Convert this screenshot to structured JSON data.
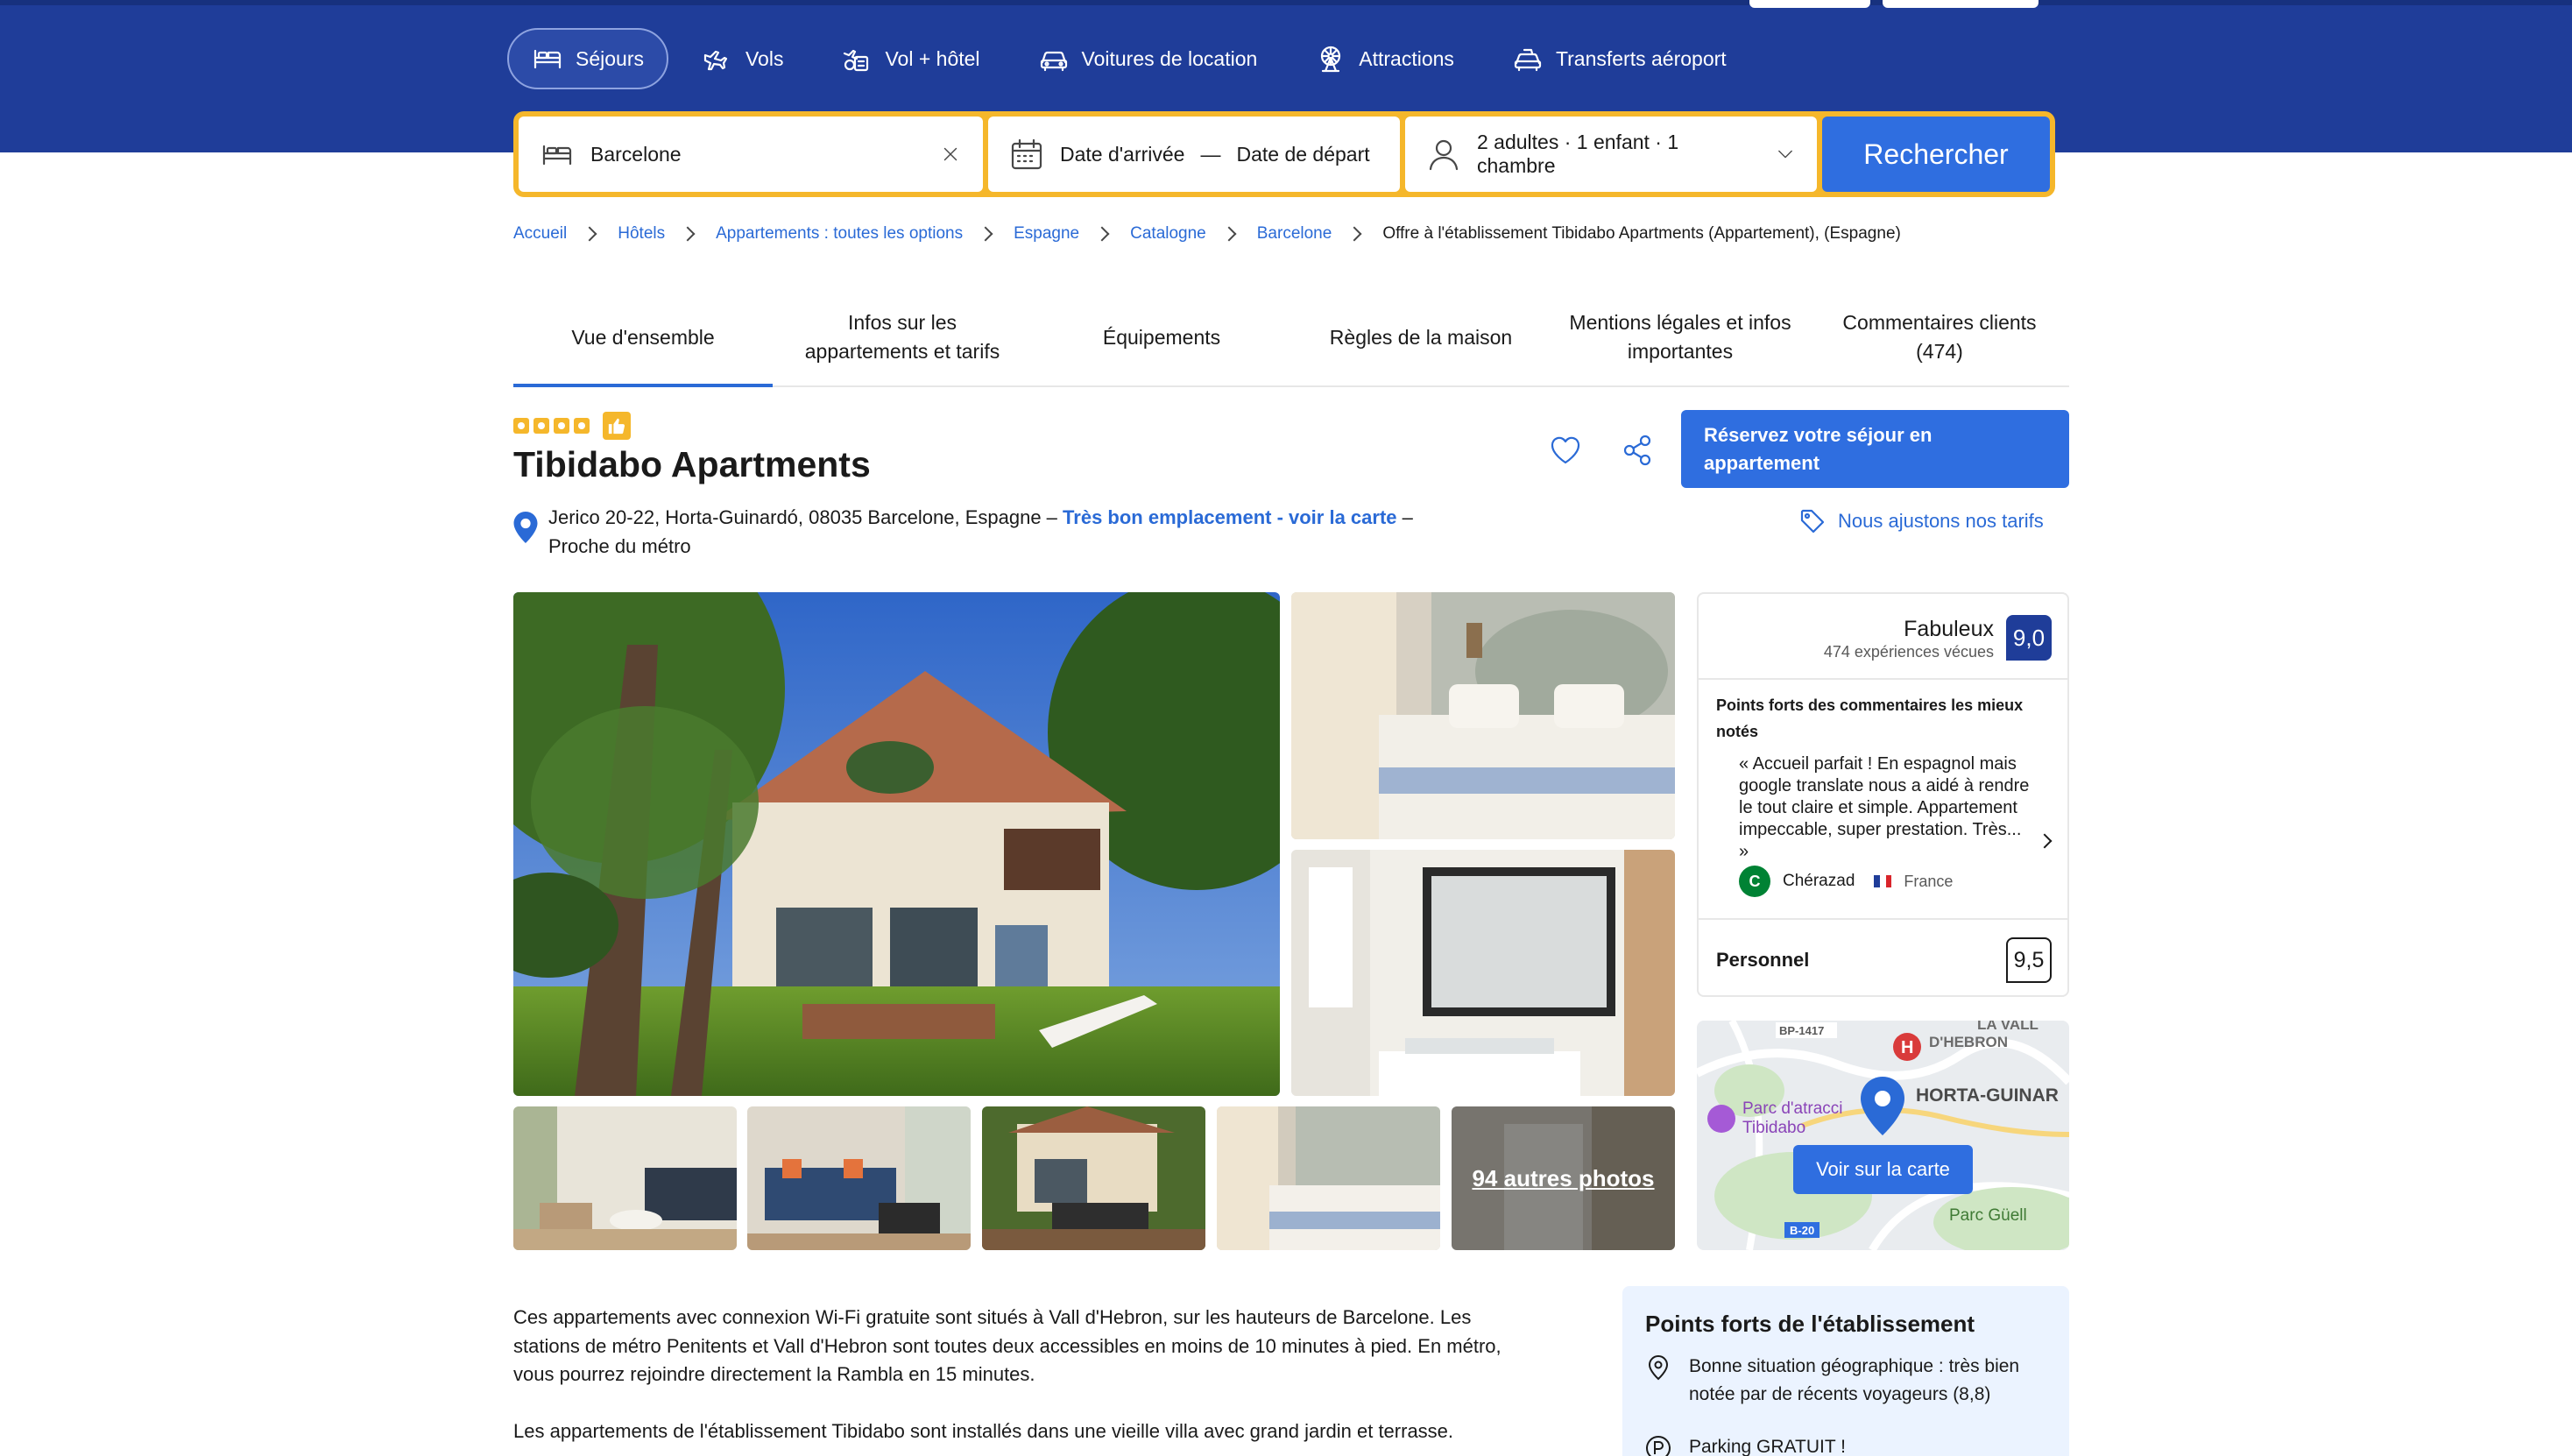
{
  "nav": {
    "items": [
      {
        "label": "Séjours",
        "icon": "bed-icon",
        "active": true
      },
      {
        "label": "Vols",
        "icon": "plane-icon",
        "active": false
      },
      {
        "label": "Vol + hôtel",
        "icon": "plane-hotel-icon",
        "active": false
      },
      {
        "label": "Voitures de location",
        "icon": "car-icon",
        "active": false
      },
      {
        "label": "Attractions",
        "icon": "ferris-wheel-icon",
        "active": false
      },
      {
        "label": "Transferts aéroport",
        "icon": "taxi-icon",
        "active": false
      }
    ]
  },
  "search": {
    "destination": "Barcelone",
    "checkin": "Date d'arrivée",
    "separator": "—",
    "checkout": "Date de départ",
    "guests": "2 adultes · 1 enfant · 1 chambre",
    "button": "Rechercher"
  },
  "breadcrumb": {
    "items": [
      "Accueil",
      "Hôtels",
      "Appartements : toutes les options",
      "Espagne",
      "Catalogne",
      "Barcelone"
    ],
    "current": "Offre à l'établissement Tibidabo Apartments (Appartement), (Espagne)"
  },
  "tabs": [
    {
      "label": "Vue d'ensemble",
      "active": true
    },
    {
      "label": "Infos sur les appartements et tarifs",
      "active": false
    },
    {
      "label": "Équipements",
      "active": false
    },
    {
      "label": "Règles de la maison",
      "active": false
    },
    {
      "label": "Mentions légales et infos importantes",
      "active": false
    },
    {
      "label": "Commentaires clients (474)",
      "active": false
    }
  ],
  "property": {
    "stars": 4,
    "name": "Tibidabo Apartments",
    "address": "Jerico 20-22, Horta-Guinardó, 08035 Barcelone, Espagne –",
    "location_link": "Très bon emplacement - voir la carte",
    "address_suffix": "–",
    "metro": "Proche du métro",
    "reserve_button": "Réservez votre séjour en appartement",
    "price_match": "Nous ajustons nos tarifs"
  },
  "gallery": {
    "more_photos": "94 autres photos"
  },
  "reviews": {
    "word": "Fabuleux",
    "count": "474 expériences vécues",
    "score": "9,0",
    "highlights_title": "Points forts des commentaires les mieux notés",
    "quote": "« Accueil parfait ! En espagnol mais google translate nous a aidé à rendre le tout claire et simple. Appartement impeccable, super prestation. Très... »",
    "author_initial": "C",
    "author": "Chérazad",
    "country": "France",
    "staff_label": "Personnel",
    "staff_score": "9,5"
  },
  "map": {
    "button": "Voir sur la carte",
    "labels": [
      "BP-1417",
      "LA VALL",
      "D'HEBRON",
      "HORTA-GUINAR",
      "Parc d'atracci",
      "Tibidabo",
      "Parc Güell",
      "B-20"
    ]
  },
  "description": {
    "p1": "Ces appartements avec connexion Wi-Fi gratuite sont situés à Vall d'Hebron, sur les hauteurs de Barcelone. Les stations de métro Penitents et Vall d'Hebron sont toutes deux accessibles en moins de 10 minutes à pied. En métro, vous pourrez rejoindre directement la Rambla en 15 minutes.",
    "p2": "Les appartements de l'établissement Tibidabo sont installés dans une vieille villa avec grand jardin et terrasse."
  },
  "highlights": {
    "title": "Points forts de l'établissement",
    "items": [
      {
        "icon": "location-pin-icon",
        "text": "Bonne situation géographique : très bien notée par de récents voyageurs (8,8)"
      },
      {
        "icon": "parking-icon",
        "text": "Parking GRATUIT !"
      }
    ]
  },
  "colors": {
    "header": "#1f3d99",
    "accent": "#2f6ee0",
    "searchbar": "#f5b72b",
    "link": "#2a6ad6"
  }
}
